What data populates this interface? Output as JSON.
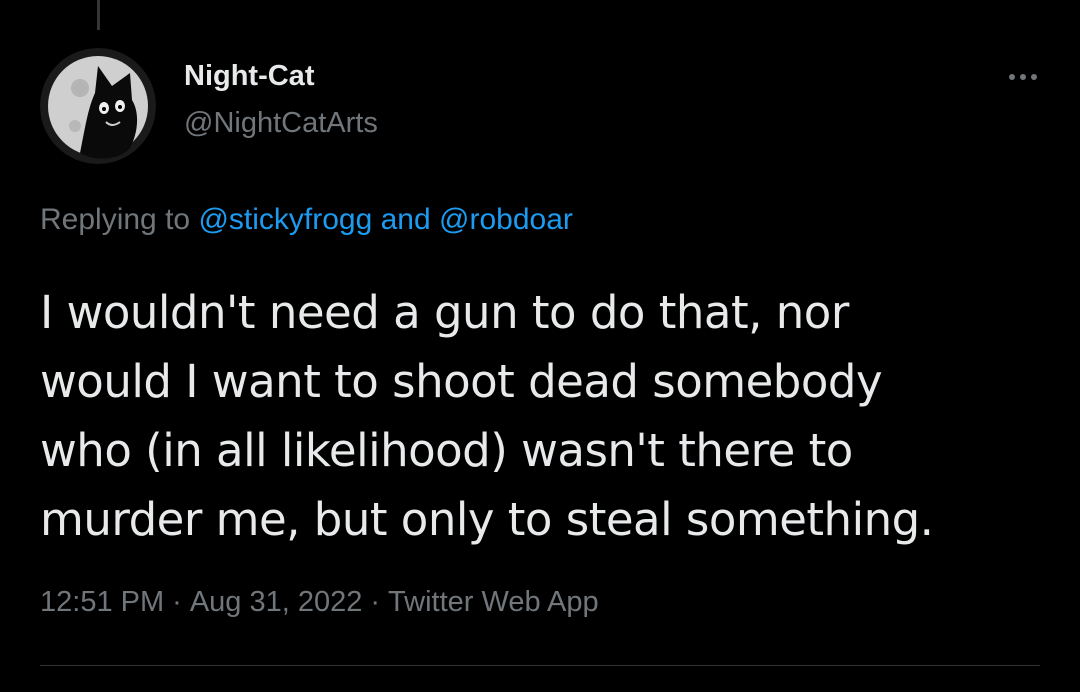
{
  "tweet": {
    "author_name": "Night-Cat",
    "author_handle": "@NightCatArts",
    "replying_prefix": "Replying to ",
    "reply_to_1": "@stickyfrogg",
    "reply_joiner": " and ",
    "reply_to_2": "@robdoar",
    "text_lines": [
      "I wouldn't need a gun to do that, nor",
      "would I want to shoot dead somebody",
      "who (in all likelihood) wasn't there to",
      "murder me, but only to steal something."
    ],
    "time": "12:51 PM",
    "date": "Aug 31, 2022",
    "source": "Twitter Web App",
    "separator": "·"
  },
  "icons": {
    "avatar": "cat-moon-avatar",
    "more": "more-horizontal-icon"
  },
  "colors": {
    "background": "#000000",
    "text_primary": "#e7e9ea",
    "text_secondary": "#71767b",
    "link": "#1d9bf0",
    "divider": "#2f3336"
  }
}
